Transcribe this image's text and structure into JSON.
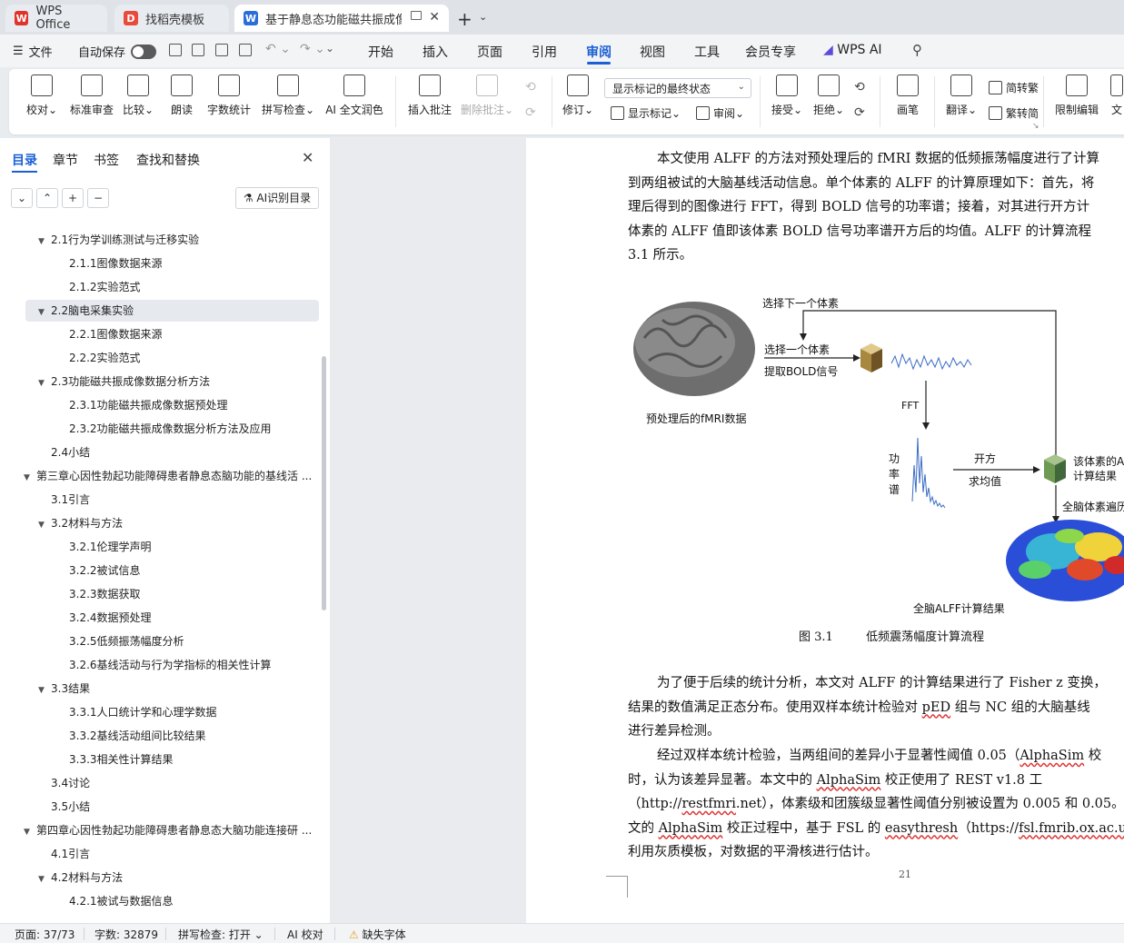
{
  "tabs": {
    "wps": "WPS Office",
    "template": "找稻壳模板",
    "document": "基于静息态功能磁共振成像的"
  },
  "menu": {
    "file": "文件",
    "autosave": "自动保存",
    "tabs": [
      "开始",
      "插入",
      "页面",
      "引用",
      "审阅",
      "视图",
      "工具",
      "会员专享",
      "WPS AI"
    ]
  },
  "ribbon": {
    "proofread": "校对",
    "standard_review": "标准审查",
    "compare": "比较",
    "read_aloud": "朗读",
    "word_count": "字数统计",
    "spell_check": "拼写检查",
    "ai_polish": "AI 全文润色",
    "insert_comment": "插入批注",
    "delete_comment": "删除批注",
    "revise": "修订",
    "markup_state": "显示标记的最终状态",
    "show_markup": "显示标记",
    "review": "审阅",
    "accept": "接受",
    "reject": "拒绝",
    "pen": "画笔",
    "translate": "翻译",
    "to_traditional": "简转繁",
    "to_simplified": "繁转简",
    "restrict_edit": "限制编辑",
    "doc_partial": "文"
  },
  "nav": {
    "tabs": [
      "目录",
      "章节",
      "书签",
      "查找和替换"
    ],
    "ai_toc": "AI识别目录",
    "toc": [
      {
        "text": "2.1行为学训练测试与迁移实验",
        "level": 2,
        "arrow": true
      },
      {
        "text": "2.1.1图像数据来源",
        "level": 3,
        "arrow": false
      },
      {
        "text": "2.1.2实验范式",
        "level": 3,
        "arrow": false
      },
      {
        "text": "2.2脑电采集实验",
        "level": 2,
        "arrow": true,
        "selected": true
      },
      {
        "text": "2.2.1图像数据来源",
        "level": 3,
        "arrow": false
      },
      {
        "text": "2.2.2实验范式",
        "level": 3,
        "arrow": false
      },
      {
        "text": "2.3功能磁共振成像数据分析方法",
        "level": 2,
        "arrow": true
      },
      {
        "text": "2.3.1功能磁共振成像数据预处理",
        "level": 3,
        "arrow": false
      },
      {
        "text": "2.3.2功能磁共振成像数据分析方法及应用",
        "level": 3,
        "arrow": false
      },
      {
        "text": "2.4小结",
        "level": 2,
        "arrow": false
      },
      {
        "text": "第三章心因性勃起功能障碍患者静息态脑功能的基线活 ...",
        "level": 1,
        "arrow": true
      },
      {
        "text": "3.1引言",
        "level": 2,
        "arrow": false
      },
      {
        "text": "3.2材料与方法",
        "level": 2,
        "arrow": true
      },
      {
        "text": "3.2.1伦理学声明",
        "level": 3,
        "arrow": false
      },
      {
        "text": "3.2.2被试信息",
        "level": 3,
        "arrow": false
      },
      {
        "text": "3.2.3数据获取",
        "level": 3,
        "arrow": false
      },
      {
        "text": "3.2.4数据预处理",
        "level": 3,
        "arrow": false
      },
      {
        "text": "3.2.5低频振荡幅度分析",
        "level": 3,
        "arrow": false
      },
      {
        "text": "3.2.6基线活动与行为学指标的相关性计算",
        "level": 3,
        "arrow": false
      },
      {
        "text": "3.3结果",
        "level": 2,
        "arrow": true
      },
      {
        "text": "3.3.1人口统计学和心理学数据",
        "level": 3,
        "arrow": false
      },
      {
        "text": "3.3.2基线活动组间比较结果",
        "level": 3,
        "arrow": false
      },
      {
        "text": "3.3.3相关性计算结果",
        "level": 3,
        "arrow": false
      },
      {
        "text": "3.4讨论",
        "level": 2,
        "arrow": false
      },
      {
        "text": "3.5小结",
        "level": 2,
        "arrow": false
      },
      {
        "text": "第四章心因性勃起功能障碍患者静息态大脑功能连接研 ...",
        "level": 1,
        "arrow": true
      },
      {
        "text": "4.1引言",
        "level": 2,
        "arrow": false
      },
      {
        "text": "4.2材料与方法",
        "level": 2,
        "arrow": true
      },
      {
        "text": "4.2.1被试与数据信息",
        "level": 3,
        "arrow": false
      }
    ]
  },
  "doc": {
    "p1": [
      "本文使用 ALFF 的方法对预处理后的 fMRI 数据的低频振荡幅度进行了计算",
      "到两组被试的大脑基线活动信息。单个体素的 ALFF 的计算原理如下：首先，将",
      "理后得到的图像进行 FFT，得到 BOLD 信号的功率谱；接着，对其进行开方计",
      "体素的 ALFF 值即该体素 BOLD 信号功率谱开方后的均值。ALFF 的计算流程",
      "3.1 所示。"
    ],
    "figure": {
      "next_voxel": "选择下一个体素",
      "select_voxel": "选择一个体素",
      "extract_bold": "提取BOLD信号",
      "preprocessed": "预处理后的fMRI数据",
      "fft": "FFT",
      "power_spectrum": [
        "功",
        "率",
        "谱"
      ],
      "sqrt": "开方",
      "mean": "求均值",
      "voxel_result_1": "该体素的A",
      "voxel_result_2": "计算结果",
      "whole_brain_loop": "全脑体素遍历",
      "whole_brain_result": "全脑ALFF计算结果",
      "caption_num": "图 3.1",
      "caption_text": "低频震荡幅度计算流程"
    },
    "p2": [
      "为了便于后续的统计分析，本文对 ALFF 的计算结果进行了 Fisher z 变换，",
      "结果的数值满足正态分布。使用双样本统计检验对 pED 组与 NC 组的大脑基线",
      "进行差异检测。"
    ],
    "p3": [
      "经过双样本统计检验，当两组间的差异小于显著性阈值 0.05（AlphaSim 校",
      "时，认为该差异显著。本文中的 AlphaSim 校正使用了 REST v1.8 工",
      "（http://restfmri.net），体素级和团簇级显著性阈值分别被设置为 0.005 和 0.05。",
      "文的 AlphaSim 校正过程中，基于 FSL 的 easythresh（https://fsl.fmrib.ox.ac.uk）",
      "利用灰质模板，对数据的平滑核进行估计。"
    ],
    "page_number": "21"
  },
  "status": {
    "page": "页面: 37/73",
    "words": "字数: 32879",
    "spell": "拼写检查: 打开",
    "ai_check": "AI 校对",
    "missing_font": "缺失字体"
  },
  "colors": {
    "accent": "#1a5fd6",
    "wps_red": "#e0332b"
  }
}
